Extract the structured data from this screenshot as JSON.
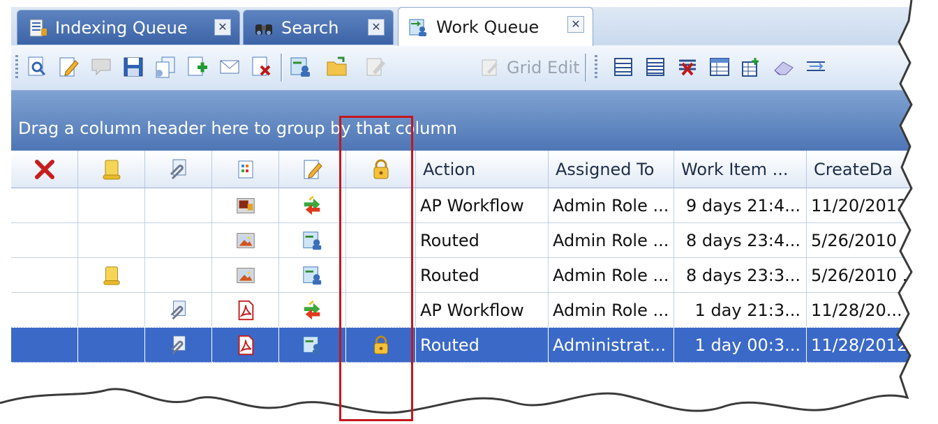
{
  "tabs": [
    {
      "label": "Indexing Queue",
      "icon": "queue-icon",
      "active": false
    },
    {
      "label": "Search",
      "icon": "binoculars-icon",
      "active": false
    },
    {
      "label": "Work Queue",
      "icon": "work-queue-icon",
      "active": true
    }
  ],
  "toolbar": {
    "grid_edit_label": "Grid Edit"
  },
  "group_panel": {
    "hint": "Drag a column header here to group by that column"
  },
  "grid": {
    "icon_columns": [
      "delete-icon",
      "note-icon",
      "attachment-icon",
      "document-type-icon",
      "workflow-icon",
      "lock-icon"
    ],
    "text_columns": [
      "Action",
      "Assigned To",
      "Work Item ...",
      "CreateDa"
    ],
    "rows": [
      {
        "note": false,
        "attachment": false,
        "doctype": "image-doc-icon",
        "workflow": "route-arrows-icon",
        "locked": false,
        "action": "AP Workflow",
        "assigned_to": "Admin Role ...",
        "work_item": "9 days 21:4...",
        "create_date": "11/20/2012..."
      },
      {
        "note": false,
        "attachment": false,
        "doctype": "picture-doc-icon",
        "workflow": "routed-user-icon",
        "locked": false,
        "action": "Routed",
        "assigned_to": "Admin Role ...",
        "work_item": "8 days 23:4...",
        "create_date": "5/26/2010 ..."
      },
      {
        "note": true,
        "attachment": false,
        "doctype": "picture-doc-icon",
        "workflow": "routed-user-icon",
        "locked": false,
        "action": "Routed",
        "assigned_to": "Admin Role ...",
        "work_item": "8 days 23:3...",
        "create_date": "5/26/2010 ..."
      },
      {
        "note": false,
        "attachment": true,
        "doctype": "pdf-icon",
        "workflow": "route-arrows-icon",
        "locked": false,
        "action": "AP Workflow",
        "assigned_to": "Admin Role ...",
        "work_item": "1 day 21:3...",
        "create_date": "11/28/20..."
      },
      {
        "note": false,
        "attachment": true,
        "doctype": "pdf-icon",
        "workflow": "routed-user-icon",
        "locked": true,
        "action": "Routed",
        "assigned_to": "Administrat...",
        "work_item": "1 day 00:3...",
        "create_date": "11/28/2012",
        "selected": true
      }
    ]
  },
  "colors": {
    "selection": "#3b69c8",
    "highlight_box": "#c4161c",
    "group_panel": "#5a80bd"
  }
}
